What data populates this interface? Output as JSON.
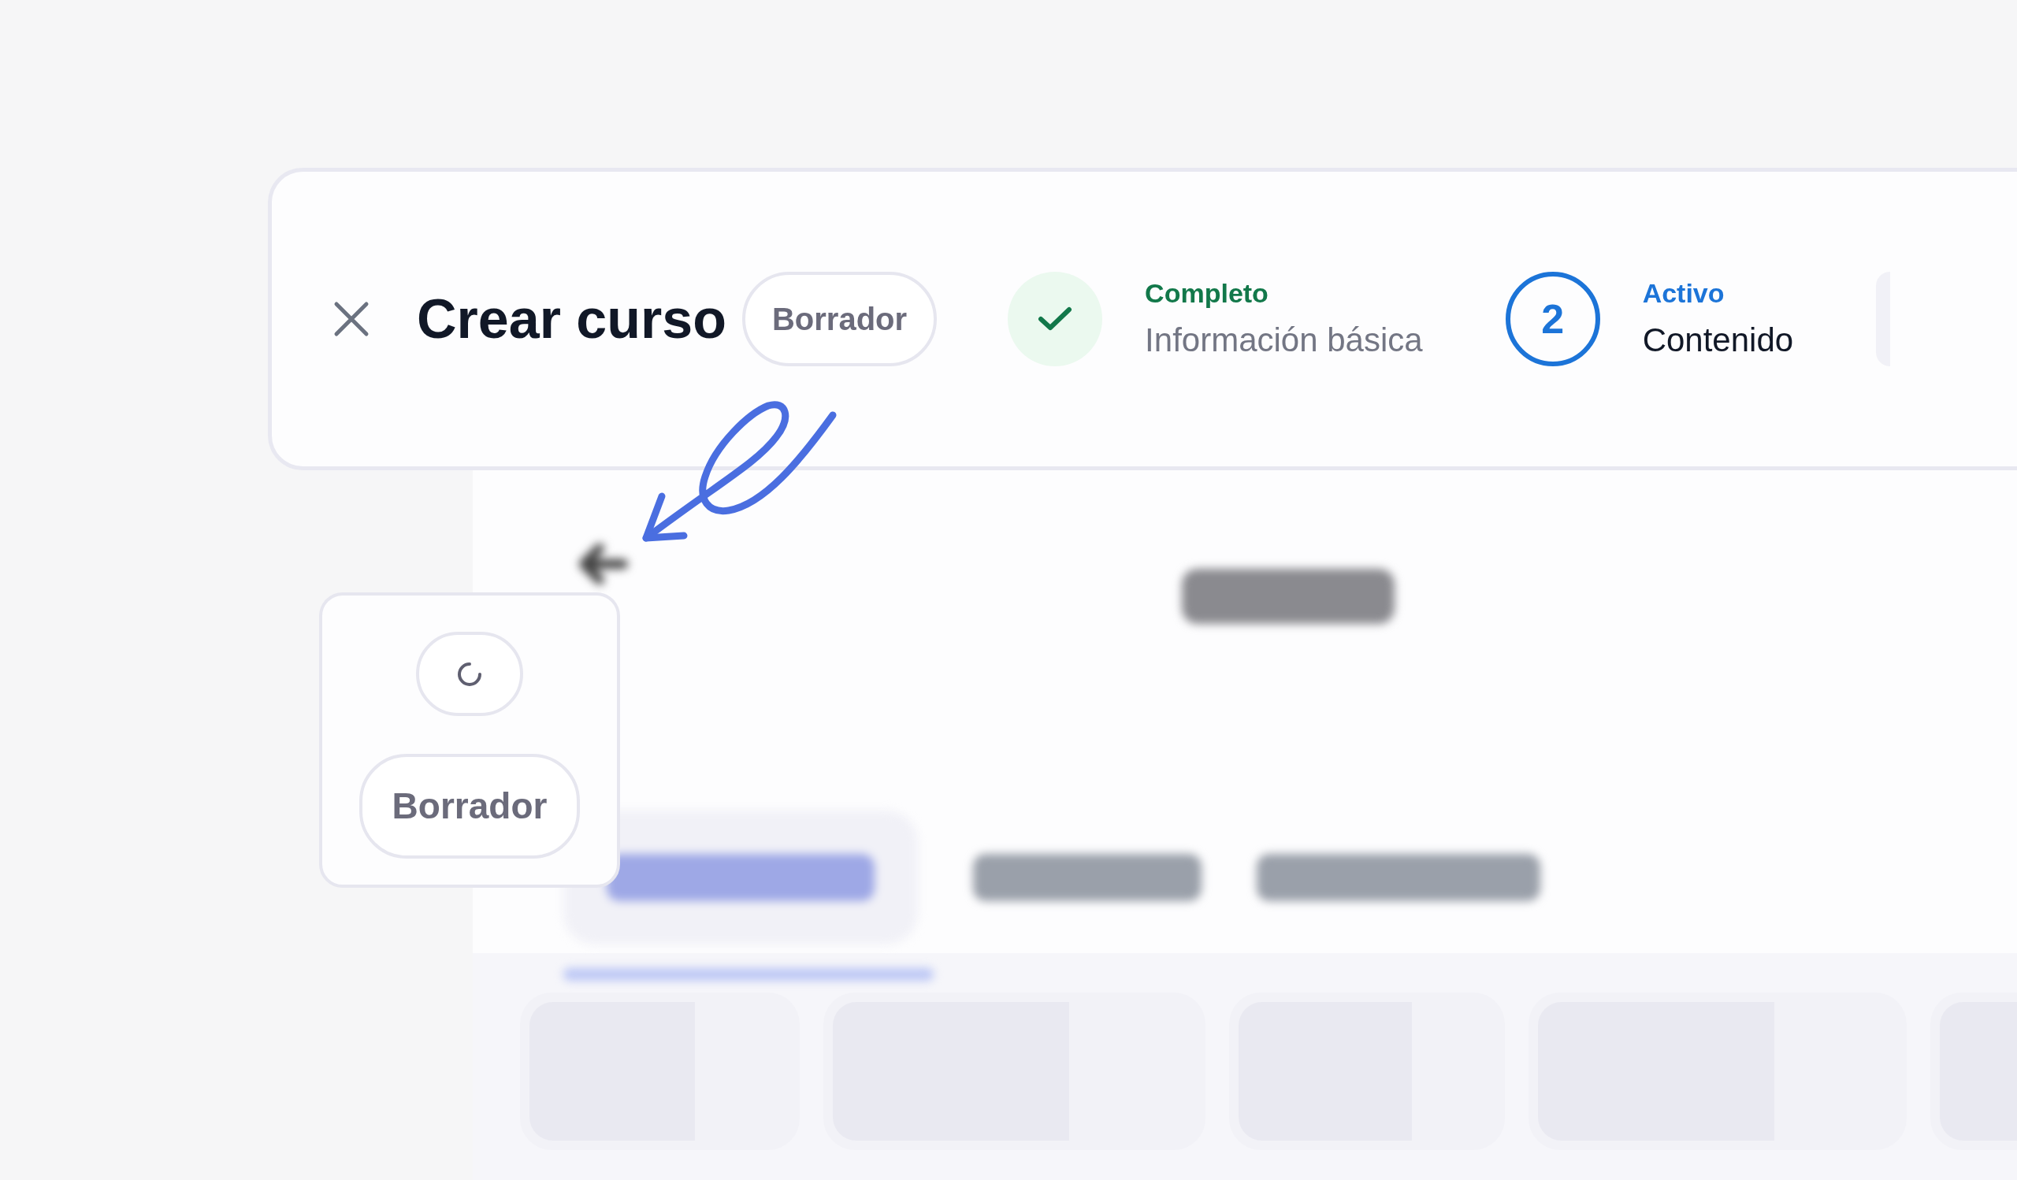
{
  "header": {
    "title": "Crear curso",
    "badge": "Borrador"
  },
  "steps": [
    {
      "kind": "complete",
      "label": "Completo",
      "title": "Información básica"
    },
    {
      "kind": "active",
      "number": "2",
      "label": "Activo",
      "title": "Contenido"
    },
    {
      "kind": "pending"
    }
  ],
  "popup": {
    "loading": true,
    "badge": "Borrador"
  }
}
